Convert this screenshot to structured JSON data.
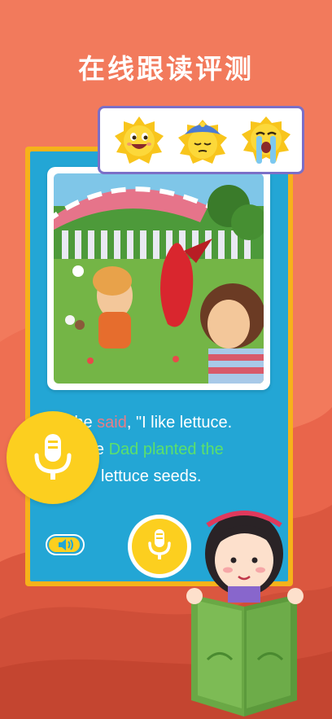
{
  "headline": "在线跟读评测",
  "story": {
    "line1": {
      "pre": "She ",
      "highlight_red": "said",
      "post": ", \"I like lettuce."
    },
    "line2": {
      "pre": "While ",
      "highlight_green": "Dad planted the"
    },
    "line3": "lettuce seeds."
  },
  "emojis": [
    {
      "name": "happy-sun-emoji",
      "mood": "happy"
    },
    {
      "name": "sleepy-cap-emoji",
      "mood": "sleepy"
    },
    {
      "name": "crying-emoji",
      "mood": "crying"
    }
  ],
  "controls": {
    "mic_big": "microphone-icon",
    "speaker_toggle": "speaker-icon",
    "mic_small": "microphone-icon"
  },
  "colors": {
    "background": "#f27a5c",
    "card_border": "#f6b21a",
    "card_fill": "#23a6d5",
    "mic_yellow": "#fccf1f",
    "highlight_red": "#e87d86",
    "highlight_green": "#5ce06b",
    "emoji_panel_border": "#7b6fc7"
  }
}
